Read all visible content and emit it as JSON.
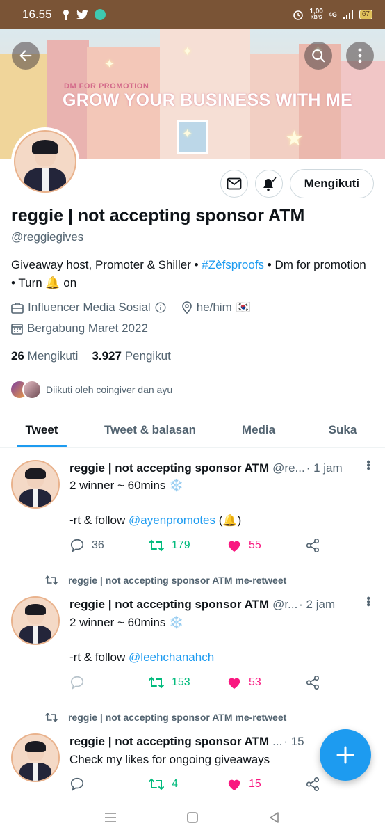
{
  "status_bar": {
    "time": "16.55",
    "net_speed_value": "1,00",
    "net_speed_unit": "KB/S",
    "network": "4G",
    "battery": "67",
    "icons": [
      "key-icon",
      "twitter-icon",
      "whatsapp-icon",
      "alarm-icon",
      "signal-icon",
      "battery-icon"
    ]
  },
  "banner": {
    "subtitle": "DM FOR PROMOTION",
    "headline": "GROW YOUR BUSINESS WITH ME"
  },
  "profile": {
    "name": "reggie | not accepting sponsor ATM",
    "handle": "@reggiegives",
    "bio_part1": "Giveaway host, Promoter & Shiller • ",
    "bio_hashtag": "#Zèfsproofs",
    "bio_part2": " • Dm for promotion • Turn 🔔 on",
    "category": "Influencer Media Sosial",
    "pronouns": "he/him",
    "flag": "🇰🇷",
    "joined": "Bergabung Maret 2022",
    "following_count": "26",
    "following_label": "Mengikuti",
    "followers_count": "3.927",
    "followers_label": "Pengikut",
    "followed_by": "Diikuti oleh coingiver dan ayu",
    "follow_button": "Mengikuti"
  },
  "tabs": [
    {
      "label": "Tweet",
      "active": true
    },
    {
      "label": "Tweet & balasan",
      "active": false
    },
    {
      "label": "Media",
      "active": false
    },
    {
      "label": "Suka",
      "active": false
    }
  ],
  "tweets": [
    {
      "retweet_label": "",
      "name": "reggie | not accepting sponsor ATM",
      "handle": "@re...",
      "time": "· 1 jam",
      "line1": "2 winner ~ 60mins ❄️",
      "line2_prefix": "-rt & follow ",
      "mention": "@ayenpromotes",
      "line2_suffix": " (🔔)",
      "replies": "36",
      "retweets": "179",
      "likes": "55"
    },
    {
      "retweet_label": "reggie | not accepting sponsor ATM me-retweet",
      "name": "reggie | not accepting sponsor ATM",
      "handle": "@r...",
      "time": "· 2 jam",
      "line1": "2 winner ~ 60mins ❄️",
      "line2_prefix": "-rt & follow ",
      "mention": "@leehchanahch",
      "line2_suffix": "",
      "replies": "",
      "retweets": "153",
      "likes": "53"
    },
    {
      "retweet_label": "reggie | not accepting sponsor ATM me-retweet",
      "name": "reggie | not accepting sponsor ATM",
      "handle": "...",
      "time": "· 15",
      "line1": "Check my likes for ongoing giveaways",
      "replies": "",
      "retweets": "4",
      "likes": "15"
    }
  ],
  "colors": {
    "accent": "#1d9bf0",
    "retweet": "#00ba7c",
    "like": "#f91880",
    "status_bar": "#7a5436"
  }
}
